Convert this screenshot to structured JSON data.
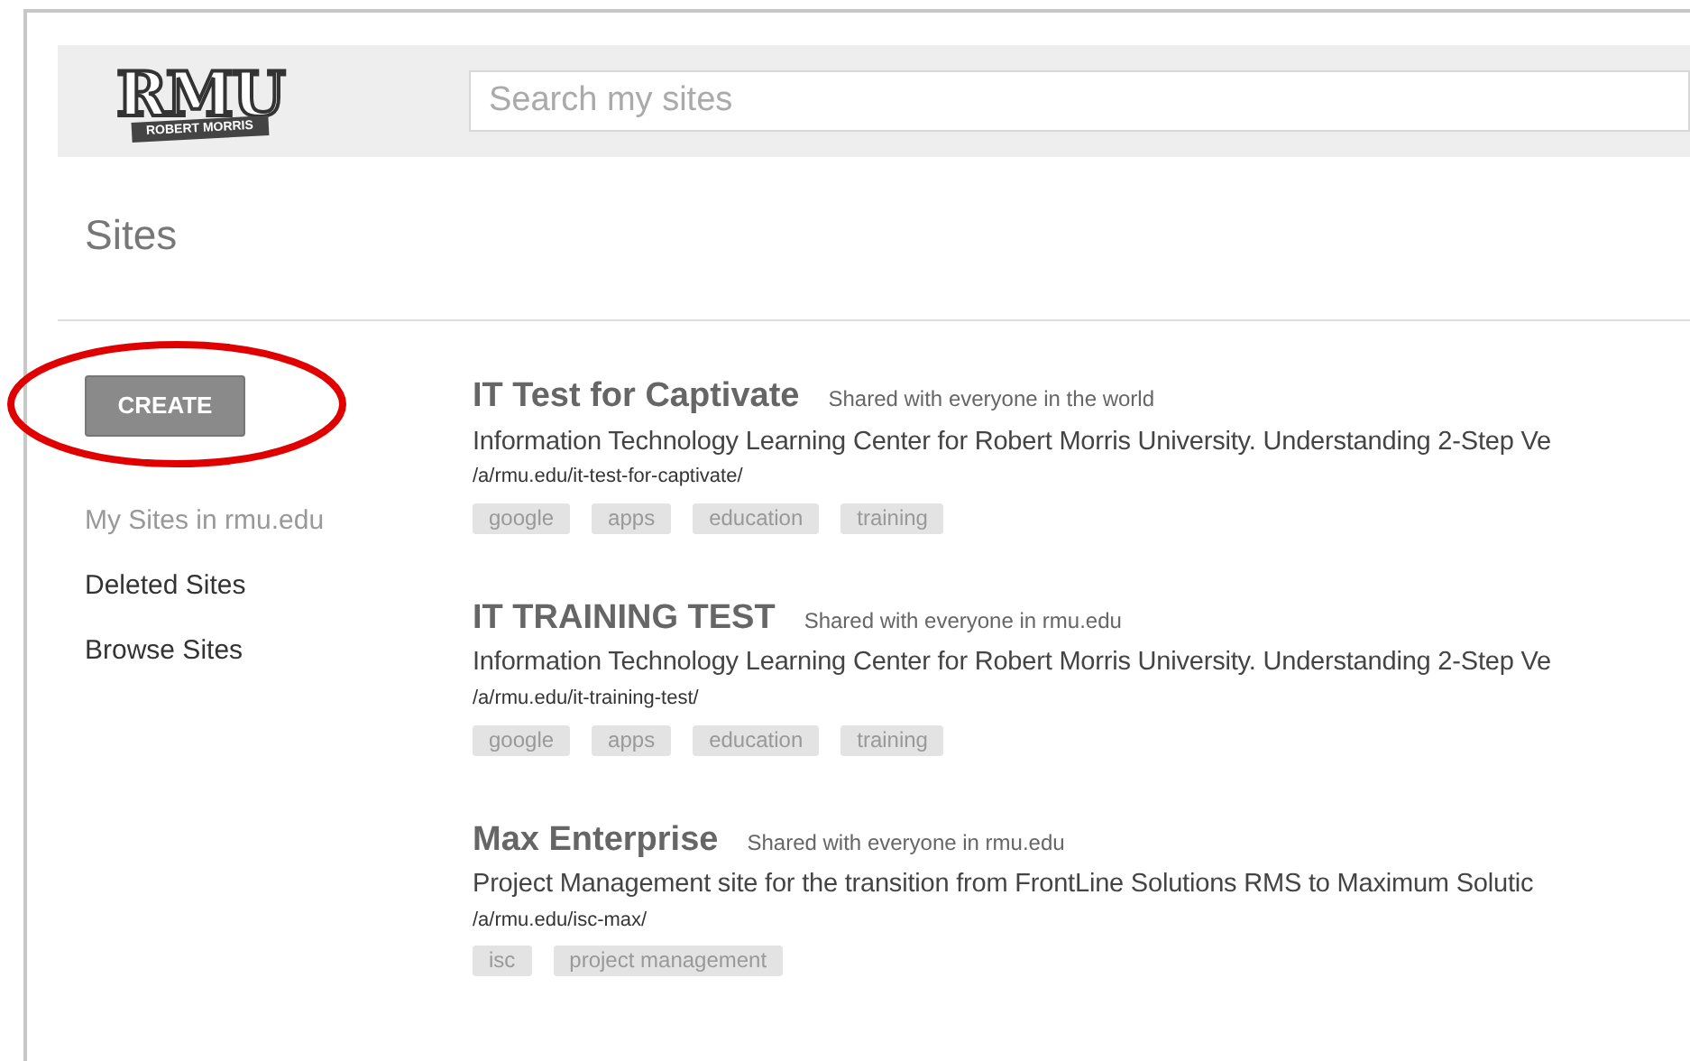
{
  "header": {
    "logo": {
      "title": "RMU",
      "subtitle": "ROBERT MORRIS"
    },
    "search": {
      "placeholder": "Search my sites"
    }
  },
  "page_title": "Sites",
  "create_button": "CREATE",
  "annotation": {
    "kind": "ellipse"
  },
  "sidebar": {
    "items": [
      {
        "label": "My Sites in rmu.edu",
        "selected": true
      },
      {
        "label": "Deleted Sites",
        "selected": false
      },
      {
        "label": "Browse Sites",
        "selected": false
      }
    ]
  },
  "sites": [
    {
      "title": "IT Test for Captivate",
      "sharing": "Shared with everyone in the world",
      "description": "Information Technology Learning Center for Robert Morris University. Understanding 2-Step Ve",
      "url": "/a/rmu.edu/it-test-for-captivate/",
      "tags": [
        "google",
        "apps",
        "education",
        "training"
      ]
    },
    {
      "title": "IT TRAINING TEST",
      "sharing": "Shared with everyone in rmu.edu",
      "description": "Information Technology Learning Center for Robert Morris University. Understanding 2-Step Ve",
      "url": "/a/rmu.edu/it-training-test/",
      "tags": [
        "google",
        "apps",
        "education",
        "training"
      ]
    },
    {
      "title": "Max Enterprise",
      "sharing": "Shared with everyone in rmu.edu",
      "description": "Project Management site for the transition from FrontLine Solutions RMS to Maximum Solutic",
      "url": "/a/rmu.edu/isc-max/",
      "tags": [
        "isc",
        "project management"
      ]
    }
  ]
}
